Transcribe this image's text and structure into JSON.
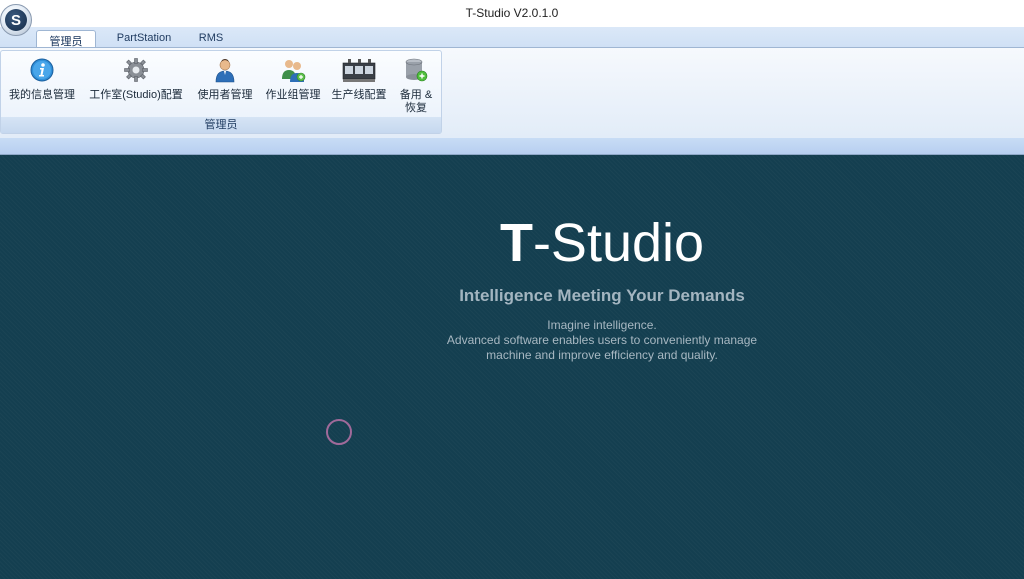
{
  "window": {
    "title": "T-Studio V2.0.1.0",
    "logo_letter": "S"
  },
  "tabs": [
    {
      "label": "管理员",
      "active": true
    },
    {
      "label": "PartStation",
      "active": false
    },
    {
      "label": "RMS",
      "active": false
    }
  ],
  "ribbon": {
    "group_label": "管理员",
    "buttons": [
      {
        "label": "我的信息管理",
        "icon": "info-icon"
      },
      {
        "label": "工作室(Studio)配置",
        "icon": "gear-icon"
      },
      {
        "label": "使用者管理",
        "icon": "user-icon"
      },
      {
        "label": "作业组管理",
        "icon": "user-group-icon"
      },
      {
        "label": "生产线配置",
        "icon": "production-line-icon"
      },
      {
        "label_line1": "备用 &",
        "label_line2": "恢复",
        "icon": "backup-restore-icon"
      }
    ]
  },
  "splash": {
    "brand_bold": "T",
    "brand_rest": "-Studio",
    "tagline": "Intelligence Meeting Your Demands",
    "desc_line1": "Imagine intelligence.",
    "desc_line2": "Advanced software enables users to conveniently manage",
    "desc_line3": "machine and improve efficiency and quality."
  },
  "colors": {
    "background": "#143f50",
    "ribbon": "#e2ecf8",
    "accent": "#1e3a5f"
  }
}
